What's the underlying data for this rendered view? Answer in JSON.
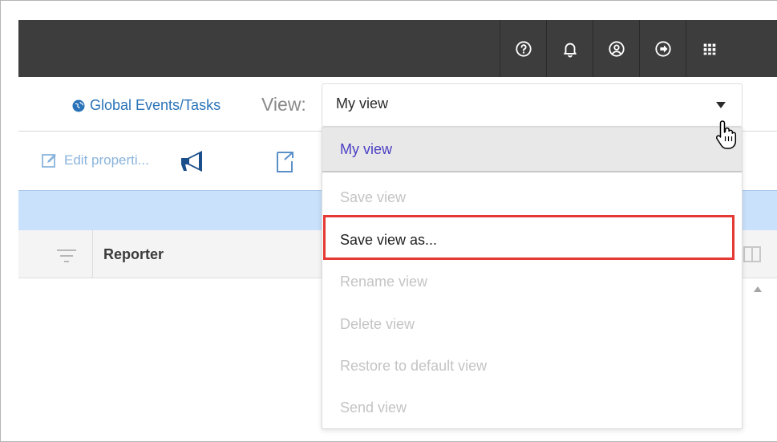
{
  "header": {
    "icons": [
      "help-icon",
      "bell-icon",
      "user-icon",
      "logout-icon",
      "apps-grid-icon"
    ]
  },
  "view_row": {
    "global_link": "Global Events/Tasks",
    "view_label": "View:"
  },
  "view_select": {
    "value": "My view"
  },
  "menu": {
    "items": [
      {
        "label": "My view",
        "state": "selected"
      },
      {
        "label": "Save view",
        "state": "disabled"
      },
      {
        "label": "Save view as...",
        "state": "enabled"
      },
      {
        "label": "Rename view",
        "state": "disabled"
      },
      {
        "label": "Delete view",
        "state": "disabled"
      },
      {
        "label": "Restore to default view",
        "state": "disabled"
      },
      {
        "label": "Send view",
        "state": "disabled"
      }
    ]
  },
  "toolbar": {
    "edit_label": "Edit properti..."
  },
  "table": {
    "columns": [
      "Reporter"
    ]
  },
  "colors": {
    "topbar": "#3d3d3d",
    "link": "#2a73b8",
    "band": "#c9e1fb",
    "highlight": "#e53935",
    "selected_text": "#4b3fc4"
  }
}
